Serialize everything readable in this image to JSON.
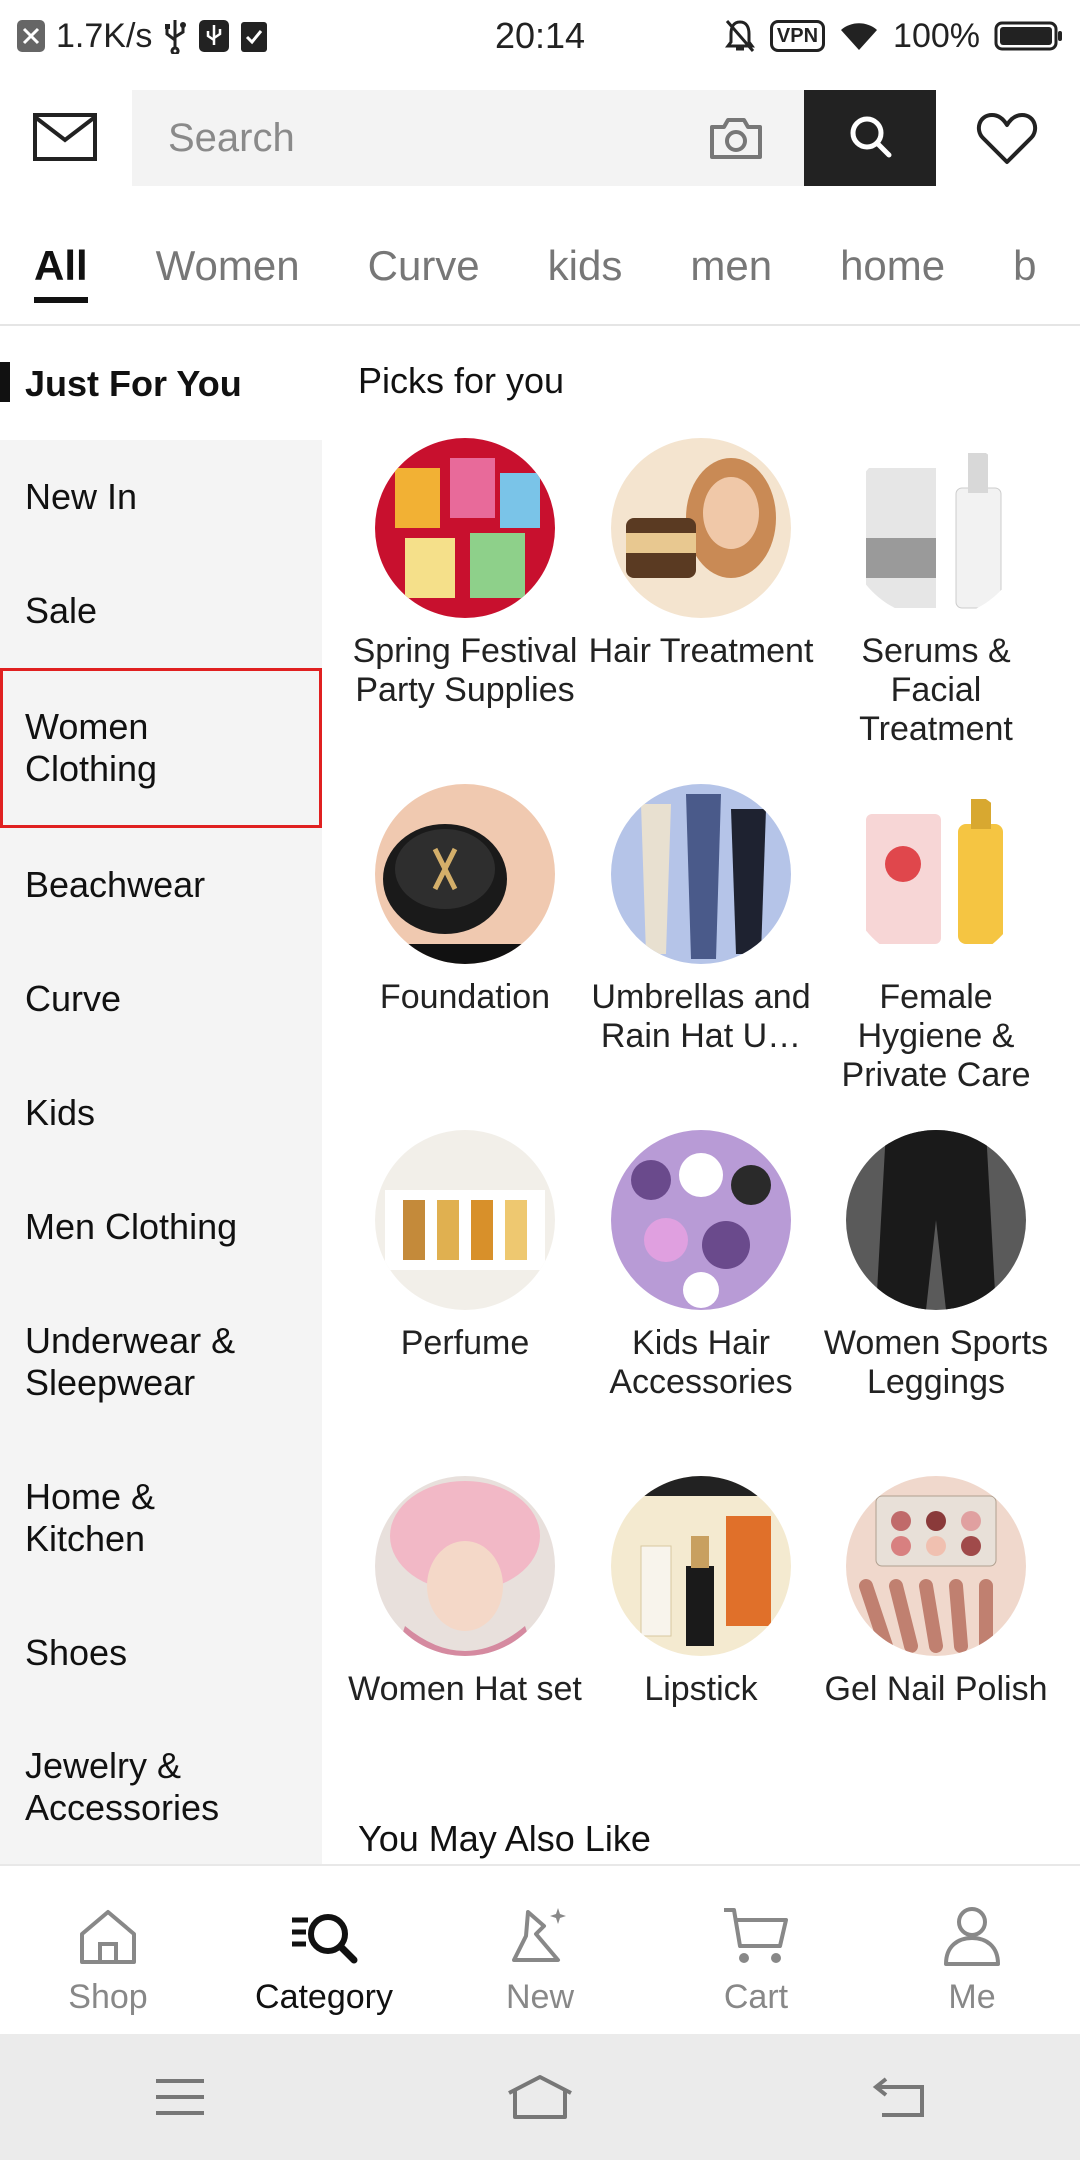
{
  "status_bar": {
    "speed": "1.7K/s",
    "time": "20:14",
    "vpn": "VPN",
    "battery": "100%",
    "icons": [
      "close-icon",
      "usb-icon",
      "usb-debug-icon",
      "clipboard-icon",
      "mute-icon",
      "wifi-icon",
      "battery-icon"
    ]
  },
  "header": {
    "search_placeholder": "Search",
    "icons": [
      "mail-icon",
      "camera-icon",
      "search-icon",
      "heart-icon"
    ]
  },
  "top_tabs": [
    "All",
    "Women",
    "Curve",
    "kids",
    "men",
    "home",
    "b"
  ],
  "sidebar": {
    "items": [
      {
        "label": "Just For You"
      },
      {
        "label": "New In"
      },
      {
        "label": "Sale"
      },
      {
        "label": "Women Clothing"
      },
      {
        "label": "Beachwear"
      },
      {
        "label": "Curve"
      },
      {
        "label": "Kids"
      },
      {
        "label": "Men Clothing"
      },
      {
        "label": "Underwear & Sleepwear"
      },
      {
        "label": "Home & Kitchen"
      },
      {
        "label": "Shoes"
      },
      {
        "label": "Jewelry & Accessories"
      }
    ]
  },
  "content": {
    "picks_title": "Picks for you",
    "items": [
      {
        "label": "Spring Festival Party Supplies",
        "colors": [
          "#c8102e",
          "#f2b134"
        ]
      },
      {
        "label": "Hair Treatment",
        "colors": [
          "#c98a55",
          "#f4e4cf"
        ]
      },
      {
        "label": "Serums & Facial Treatment",
        "colors": [
          "#e6e6e6",
          "#9a9a9a"
        ]
      },
      {
        "label": "Foundation",
        "colors": [
          "#1a1a1a",
          "#f0c9b0"
        ]
      },
      {
        "label": "Umbrellas and Rain Hat U…",
        "colors": [
          "#b5c4e8",
          "#4a5a8a"
        ]
      },
      {
        "label": "Female Hygiene & Private Care",
        "colors": [
          "#f7d6d6",
          "#e0474c"
        ]
      },
      {
        "label": "Perfume",
        "colors": [
          "#f2efe9",
          "#c48a3a"
        ]
      },
      {
        "label": "Kids Hair Accessories",
        "colors": [
          "#b89bd6",
          "#6a4a8c"
        ]
      },
      {
        "label": "Women Sports Leggings",
        "colors": [
          "#2a2a2a",
          "#5a5a5a"
        ]
      },
      {
        "label": "Women Hat set",
        "colors": [
          "#f2b8c6",
          "#d58aa0"
        ]
      },
      {
        "label": "Lipstick",
        "colors": [
          "#f4ead0",
          "#e0702a"
        ]
      },
      {
        "label": "Gel Nail Polish",
        "colors": [
          "#f0d8cc",
          "#c06a6a"
        ]
      }
    ],
    "also_like_title": "You May Also Like"
  },
  "bottom_nav": [
    {
      "label": "Shop",
      "icon": "shop-icon"
    },
    {
      "label": "Category",
      "icon": "category-icon"
    },
    {
      "label": "New",
      "icon": "new-icon"
    },
    {
      "label": "Cart",
      "icon": "cart-icon"
    },
    {
      "label": "Me",
      "icon": "me-icon"
    }
  ],
  "system_nav": [
    "menu-icon",
    "home-icon",
    "back-icon"
  ]
}
